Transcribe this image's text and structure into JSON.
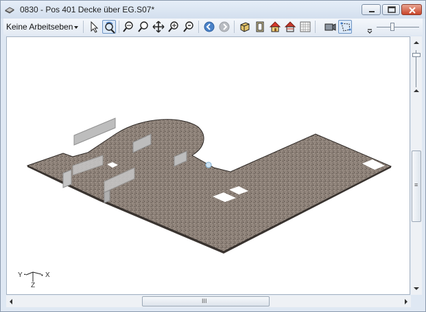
{
  "window": {
    "title": "0830 - Pos 401 Decke über EG.S07*"
  },
  "toolbar": {
    "layer_dropdown": "Keine Arbeitseben",
    "tools": [
      {
        "icon": "select-arrow-icon"
      },
      {
        "icon": "rotate-view-icon",
        "active": true
      },
      {
        "icon": "zoom-in-icon"
      },
      {
        "icon": "zoom-icon"
      },
      {
        "icon": "pan-icon"
      },
      {
        "icon": "zoom-window-icon"
      },
      {
        "icon": "zoom-out-icon"
      },
      {
        "icon": "back-icon"
      },
      {
        "icon": "forward-icon"
      },
      {
        "icon": "3d-box-icon"
      },
      {
        "icon": "door-icon"
      },
      {
        "icon": "house-icon"
      },
      {
        "icon": "house-section-icon"
      },
      {
        "icon": "grid-icon"
      },
      {
        "icon": "camera-icon"
      },
      {
        "icon": "lasso-icon",
        "active": true
      }
    ]
  },
  "viewport": {
    "axis": {
      "x": "X",
      "y": "Y",
      "z": "Z"
    }
  },
  "scrollbars": {
    "horizontal_grip": "III",
    "vertical_grip": "≡"
  },
  "colors": {
    "slab": "#8d8178",
    "slab_edge": "#2b2623",
    "wall": "#b9b9b9",
    "accent": "#3b78c7"
  }
}
